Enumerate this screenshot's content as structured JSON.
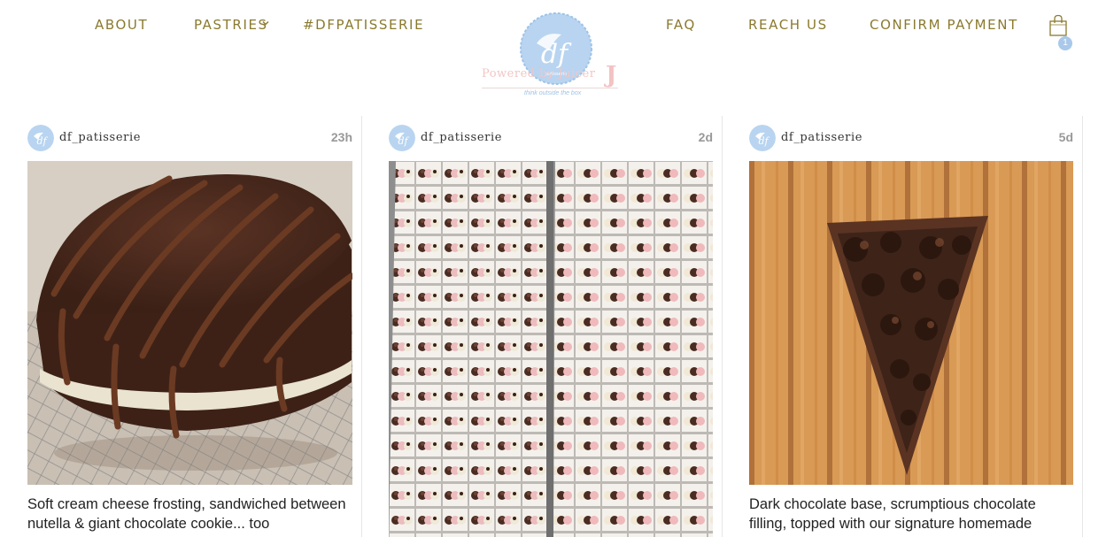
{
  "nav": {
    "about": "ABOUT",
    "pastries": "PASTRIES",
    "hashtag": "#DFPATISSERIE",
    "faq": "FAQ",
    "reach_us": "REACH US",
    "confirm_payment": "CONFIRM PAYMENT"
  },
  "logo": {
    "monogram": "df",
    "small_text": "patisserie",
    "powered": "Powered by Juicer",
    "powered_mark": "J",
    "tagline": "think outside the box"
  },
  "cart": {
    "count": "1"
  },
  "colors": {
    "nav_text": "#8a7a2e",
    "brand_blue": "#a9c8ea",
    "time_gray": "#999999"
  },
  "posts": [
    {
      "username": "df_patisserie",
      "time": "23h",
      "caption": "Soft cream cheese frosting, sandwiched between nutella & giant chocolate cookie... too"
    },
    {
      "username": "df_patisserie",
      "time": "2d",
      "caption": ""
    },
    {
      "username": "df_patisserie",
      "time": "5d",
      "caption": "Dark chocolate base, scrumptious chocolate filling, topped with our signature homemade"
    }
  ]
}
